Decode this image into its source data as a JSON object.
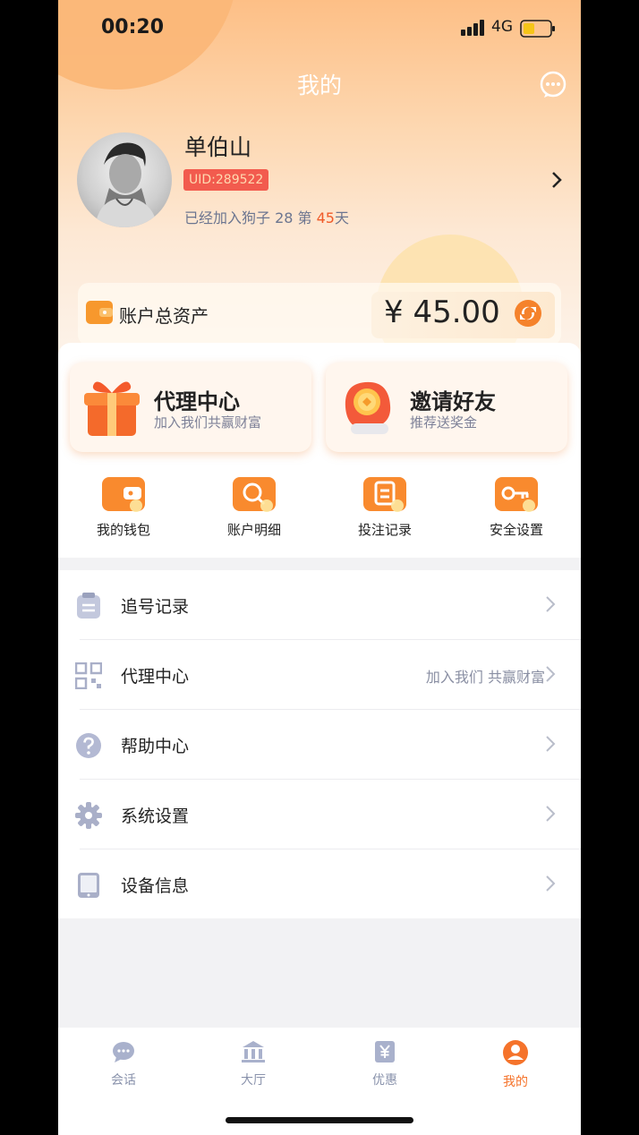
{
  "status_bar": {
    "time": "00:20",
    "network": "4G"
  },
  "header": {
    "title": "我的",
    "message_icon": "chat-bubble-icon"
  },
  "profile": {
    "username": "单伯山",
    "uid": "UID:289522",
    "join_prefix": "已经加入狗子 28 第 ",
    "join_days": "45",
    "join_suffix": "天"
  },
  "asset": {
    "label": "账户总资产",
    "value": "¥ 45.00"
  },
  "promos": [
    {
      "title": "代理中心",
      "subtitle": "加入我们共赢财富",
      "icon": "gift-box-icon"
    },
    {
      "title": "邀请好友",
      "subtitle": "推荐送奖金",
      "icon": "hand-coin-icon"
    }
  ],
  "quick_actions": [
    {
      "label": "我的钱包",
      "icon": "wallet-icon"
    },
    {
      "label": "账户明细",
      "icon": "search-folder-icon"
    },
    {
      "label": "投注记录",
      "icon": "record-icon"
    },
    {
      "label": "安全设置",
      "icon": "key-icon"
    }
  ],
  "menu": [
    {
      "label": "追号记录",
      "extra": "",
      "icon": "clipboard-icon"
    },
    {
      "label": "代理中心",
      "extra": "加入我们 共赢财富",
      "icon": "qr-code-icon"
    },
    {
      "label": "帮助中心",
      "extra": "",
      "icon": "help-icon"
    },
    {
      "label": "系统设置",
      "extra": "",
      "icon": "gear-icon"
    },
    {
      "label": "设备信息",
      "extra": "",
      "icon": "tablet-icon"
    }
  ],
  "tabs": [
    {
      "label": "会话",
      "icon": "chat-icon",
      "active": false
    },
    {
      "label": "大厅",
      "icon": "bank-icon",
      "active": false
    },
    {
      "label": "优惠",
      "icon": "coupon-icon",
      "active": false
    },
    {
      "label": "我的",
      "icon": "user-icon",
      "active": true
    }
  ],
  "colors": {
    "accent": "#f5732b",
    "uid_badge": "#f25b4e",
    "highlight": "#f05a28"
  }
}
